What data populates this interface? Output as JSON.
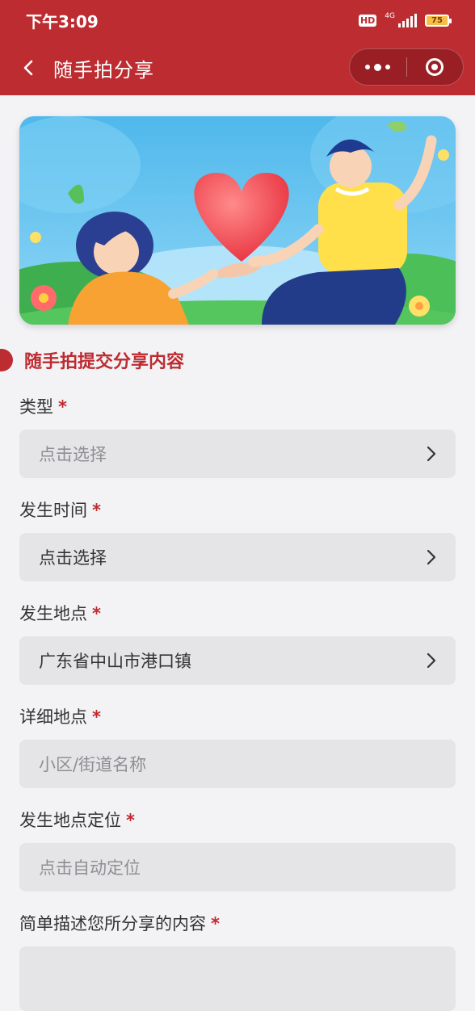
{
  "status": {
    "time": "下午3:09",
    "hd": "HD",
    "network": "4G",
    "battery": "75"
  },
  "nav": {
    "title": "随手拍分享",
    "more_icon": "more-dots-icon",
    "close_icon": "target-circle-icon"
  },
  "section": {
    "title": "随手拍提交分享内容"
  },
  "form": {
    "type": {
      "label": "类型",
      "required": "*",
      "placeholder": "点击选择"
    },
    "time": {
      "label": "发生时间",
      "required": "*",
      "value": "点击选择"
    },
    "place": {
      "label": "发生地点",
      "required": "*",
      "value": "广东省中山市港口镇"
    },
    "detail": {
      "label": "详细地点",
      "required": "*",
      "placeholder": "小区/街道名称"
    },
    "locate": {
      "label": "发生地点定位",
      "required": "*",
      "placeholder": "点击自动定位"
    },
    "desc": {
      "label": "简单描述您所分享的内容",
      "required": "*"
    }
  },
  "colors": {
    "brand": "#bd2c31",
    "field_bg": "#e5e5e7",
    "page_bg": "#f3f3f6"
  }
}
